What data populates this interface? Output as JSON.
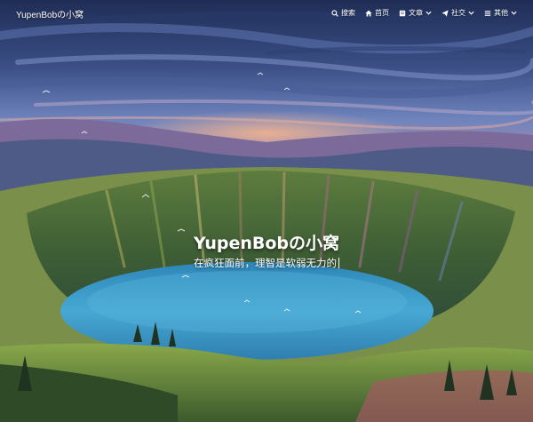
{
  "site": {
    "brand": "YupenBobの小窝",
    "title": "YupenBobの小窝",
    "subtitle": "在疯狂面前，理智是软弱无力的"
  },
  "nav": {
    "items": [
      {
        "label": "搜索",
        "icon": "search-icon",
        "has_dropdown": false
      },
      {
        "label": "首页",
        "icon": "home-icon",
        "has_dropdown": false
      },
      {
        "label": "文章",
        "icon": "book-icon",
        "has_dropdown": true
      },
      {
        "label": "社交",
        "icon": "paper-plane-icon",
        "has_dropdown": true
      },
      {
        "label": "其他",
        "icon": "list-icon",
        "has_dropdown": true
      }
    ]
  },
  "colors": {
    "sky_top": "#2a3c6b",
    "sky_mid": "#5a6fa8",
    "horizon_glow": "#f0a887",
    "lake": "#3f9ec8",
    "grass": "#6f9a3c",
    "text": "#ffffff"
  }
}
